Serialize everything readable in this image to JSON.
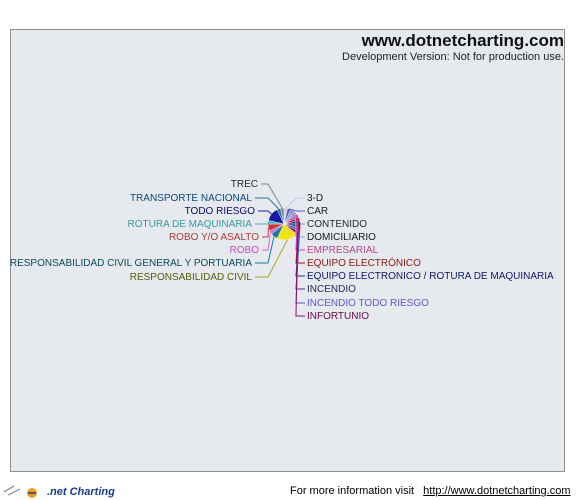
{
  "watermark": {
    "title": "www.dotnetcharting.com",
    "subtitle": "Development Version: Not for production use."
  },
  "footer": {
    "logo_text": ".net Charting",
    "info_text": "For more information visit",
    "info_link": "http://www.dotnetcharting.com"
  },
  "chart_data": {
    "type": "pie",
    "title": "",
    "legend": "none",
    "slices": [
      {
        "label": "3-D",
        "value": 1,
        "color": "#c9c6f2"
      },
      {
        "label": "CAR",
        "value": 1,
        "color": "#5c5fae"
      },
      {
        "label": "CONTENIDO",
        "value": 1,
        "color": "#8a8fd6"
      },
      {
        "label": "DOMICILIARIO",
        "value": 1,
        "color": "#9a9cd8"
      },
      {
        "label": "EMPRESARIAL",
        "value": 1,
        "color": "#d23fb0"
      },
      {
        "label": "EQUIPO ELECTRÓNICO",
        "value": 1,
        "color": "#b01224"
      },
      {
        "label": "EQUIPO ELECTRONICO / ROTURA DE MAQUINARIA",
        "value": 1,
        "color": "#1c2a8c"
      },
      {
        "label": "INCENDIO",
        "value": 1,
        "color": "#3a3a8a"
      },
      {
        "label": "INCENDIO TODO RIESGO",
        "value": 1,
        "color": "#4e55d0"
      },
      {
        "label": "INFORTUNIO",
        "value": 1,
        "color": "#8a0f6e"
      },
      {
        "label": "RESPONSABILIDAD CIVIL",
        "value": 6,
        "color": "#f2e21a"
      },
      {
        "label": "RESPONSABILIDAD CIVIL GENERAL Y PORTUARIA",
        "value": 2,
        "color": "#1a7aa0"
      },
      {
        "label": "ROBO",
        "value": 1,
        "color": "#d06ad0"
      },
      {
        "label": "ROBO Y/O ASALTO",
        "value": 2,
        "color": "#c83a3a"
      },
      {
        "label": "ROTURA DE MAQUINARIA",
        "value": 1,
        "color": "#4fb6b6"
      },
      {
        "label": "TODO RIESGO",
        "value": 4,
        "color": "#1a1aa8"
      },
      {
        "label": "TRANSPORTE NACIONAL",
        "value": 1,
        "color": "#1e7a9a"
      },
      {
        "label": "TREC",
        "value": 1,
        "color": "#888888"
      }
    ],
    "label_colors": {
      "3-D": "#1a1a1a",
      "CAR": "#1a1a1a",
      "CONTENIDO": "#2a2a2a",
      "DOMICILIARIO": "#1a1a1a",
      "EMPRESARIAL": "#b0488a",
      "EQUIPO ELECTRÓNICO": "#8a1a10",
      "EQUIPO ELECTRONICO / ROTURA DE MAQUINARIA": "#0a1a6a",
      "INCENDIO": "#2a2a5a",
      "INCENDIO TODO RIESGO": "#5a5ad0",
      "INFORTUNIO": "#6a0a4a",
      "RESPONSABILIDAD CIVIL": "#5a5a0a",
      "RESPONSABILIDAD CIVIL GENERAL Y PORTUARIA": "#0a4a5a",
      "ROBO": "#c050c0",
      "ROBO Y/O ASALTO": "#b03a3a",
      "ROTURA DE MAQUINARIA": "#3a9a9a",
      "TODO RIESGO": "#0a0a6a",
      "TRANSPORTE NACIONAL": "#0a4a7a",
      "TREC": "#2a2a2a"
    }
  }
}
